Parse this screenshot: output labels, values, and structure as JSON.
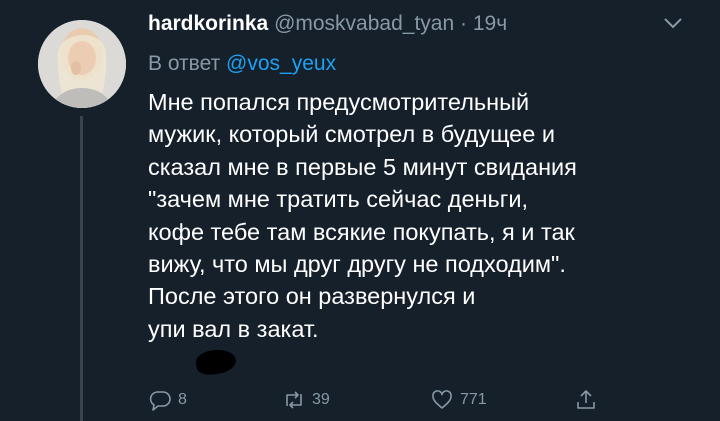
{
  "tweet": {
    "display_name": "hardkorinka",
    "handle": "@moskvabad_tyan",
    "separator": "·",
    "time": "19ч",
    "reply_prefix": "В ответ",
    "reply_to": "@vos_yeux",
    "text_lines": [
      "Мне попался предусмотрительный",
      "мужик, который смотрел в будущее и",
      "сказал мне в первые 5 минут свидания",
      "\"зачем мне тратить сейчас деньги,",
      "кофе тебе там всякие покупать, я и так",
      "вижу, что мы друг другу не подходим\".",
      "После этого он развернулся и",
      "упи     вал в закат."
    ]
  },
  "actions": {
    "reply_count": "8",
    "retweet_count": "39",
    "like_count": "771"
  },
  "icons": {
    "more": "chevron-down-icon",
    "reply": "reply-bubble-icon",
    "retweet": "retweet-icon",
    "like": "heart-icon",
    "share": "share-icon"
  },
  "colors": {
    "background": "#15202b",
    "secondary_text": "#8899a6",
    "mention": "#1da1f2",
    "thread_line": "#38444d"
  }
}
